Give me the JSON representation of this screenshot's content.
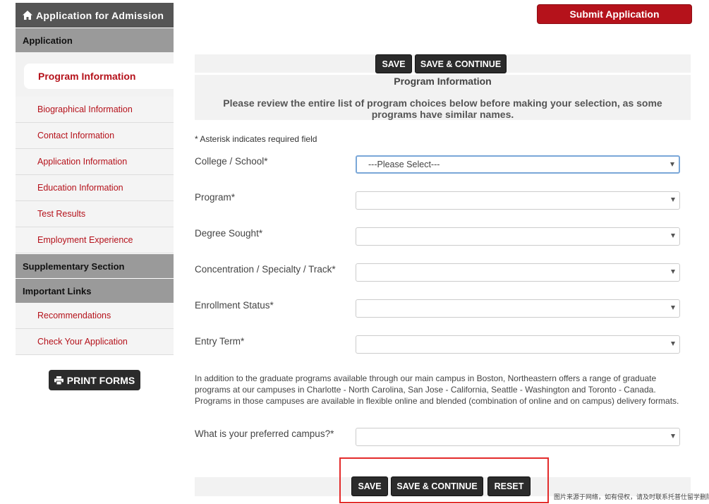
{
  "sidebar": {
    "header": "Application for Admission",
    "section_application": "Application",
    "active_item": "Program Information",
    "items": [
      "Biographical Information",
      "Contact Information",
      "Application Information",
      "Education Information",
      "Test Results",
      "Employment Experience"
    ],
    "section_supplementary": "Supplementary Section",
    "section_links": "Important Links",
    "link_items": [
      "Recommendations",
      "Check Your Application"
    ],
    "print_label": "PRINT FORMS"
  },
  "header": {
    "submit_label": "Submit Application"
  },
  "top_panel": {
    "save_label": "SAVE",
    "save_continue_label": "SAVE & CONTINUE",
    "title": "Program Information",
    "note": "Please review the entire list of program choices below before making your selection, as some programs have similar names."
  },
  "form": {
    "required_note": "* Asterisk indicates required field",
    "fields": [
      {
        "label": "College / School*",
        "value": "---Please Select---"
      },
      {
        "label": "Program*",
        "value": ""
      },
      {
        "label": "Degree Sought*",
        "value": ""
      },
      {
        "label": "Concentration / Specialty / Track*",
        "value": ""
      },
      {
        "label": "Enrollment Status*",
        "value": ""
      },
      {
        "label": "Entry Term*",
        "value": ""
      }
    ],
    "campus_info": "In addition to the graduate programs available through our main campus in Boston, Northeastern offers a range of graduate programs at our campuses in Charlotte - North Carolina, San Jose - California, Seattle - Washington and Toronto - Canada. Programs in those campuses are available in flexible online and blended (combination of online and on campus) delivery formats.",
    "campus_label": "What is your preferred campus?*",
    "campus_value": ""
  },
  "bottom_panel": {
    "save_label": "SAVE",
    "save_continue_label": "SAVE & CONTINUE",
    "reset_label": "RESET"
  },
  "watermark": "图片来源于网络，如有侵权，请及时联系托普仕留学删除",
  "colors": {
    "brand_red": "#b5121b",
    "dark_button": "#2b2b2b",
    "sidebar_section": "#9a9a9a"
  }
}
